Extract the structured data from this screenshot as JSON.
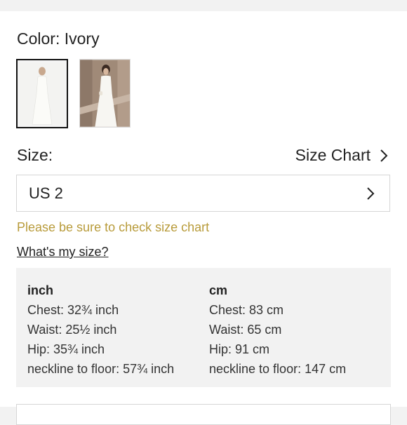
{
  "product": {
    "color_label": "Color: Ivory",
    "thumbnails": [
      {
        "name": "ivory-dress-front",
        "selected": true
      },
      {
        "name": "ivory-dress-model",
        "selected": false
      }
    ]
  },
  "size": {
    "label": "Size:",
    "size_chart_label": "Size Chart",
    "selected_value": "US 2",
    "warning": "Please be sure to check size chart",
    "whats_my_size": "What's my size?"
  },
  "measurements": {
    "inch": {
      "header": "inch",
      "rows": [
        "Chest: 32¾ inch",
        "Waist: 25½ inch",
        "Hip: 35¾ inch",
        "neckline to floor: 57¾ inch"
      ]
    },
    "cm": {
      "header": "cm",
      "rows": [
        "Chest: 83 cm",
        "Waist: 65 cm",
        "Hip: 91 cm",
        "neckline to floor: 147 cm"
      ]
    }
  },
  "colors": {
    "warning": "#b89b3a",
    "border": "#d6d6d6",
    "background": "#f2f2f2"
  }
}
